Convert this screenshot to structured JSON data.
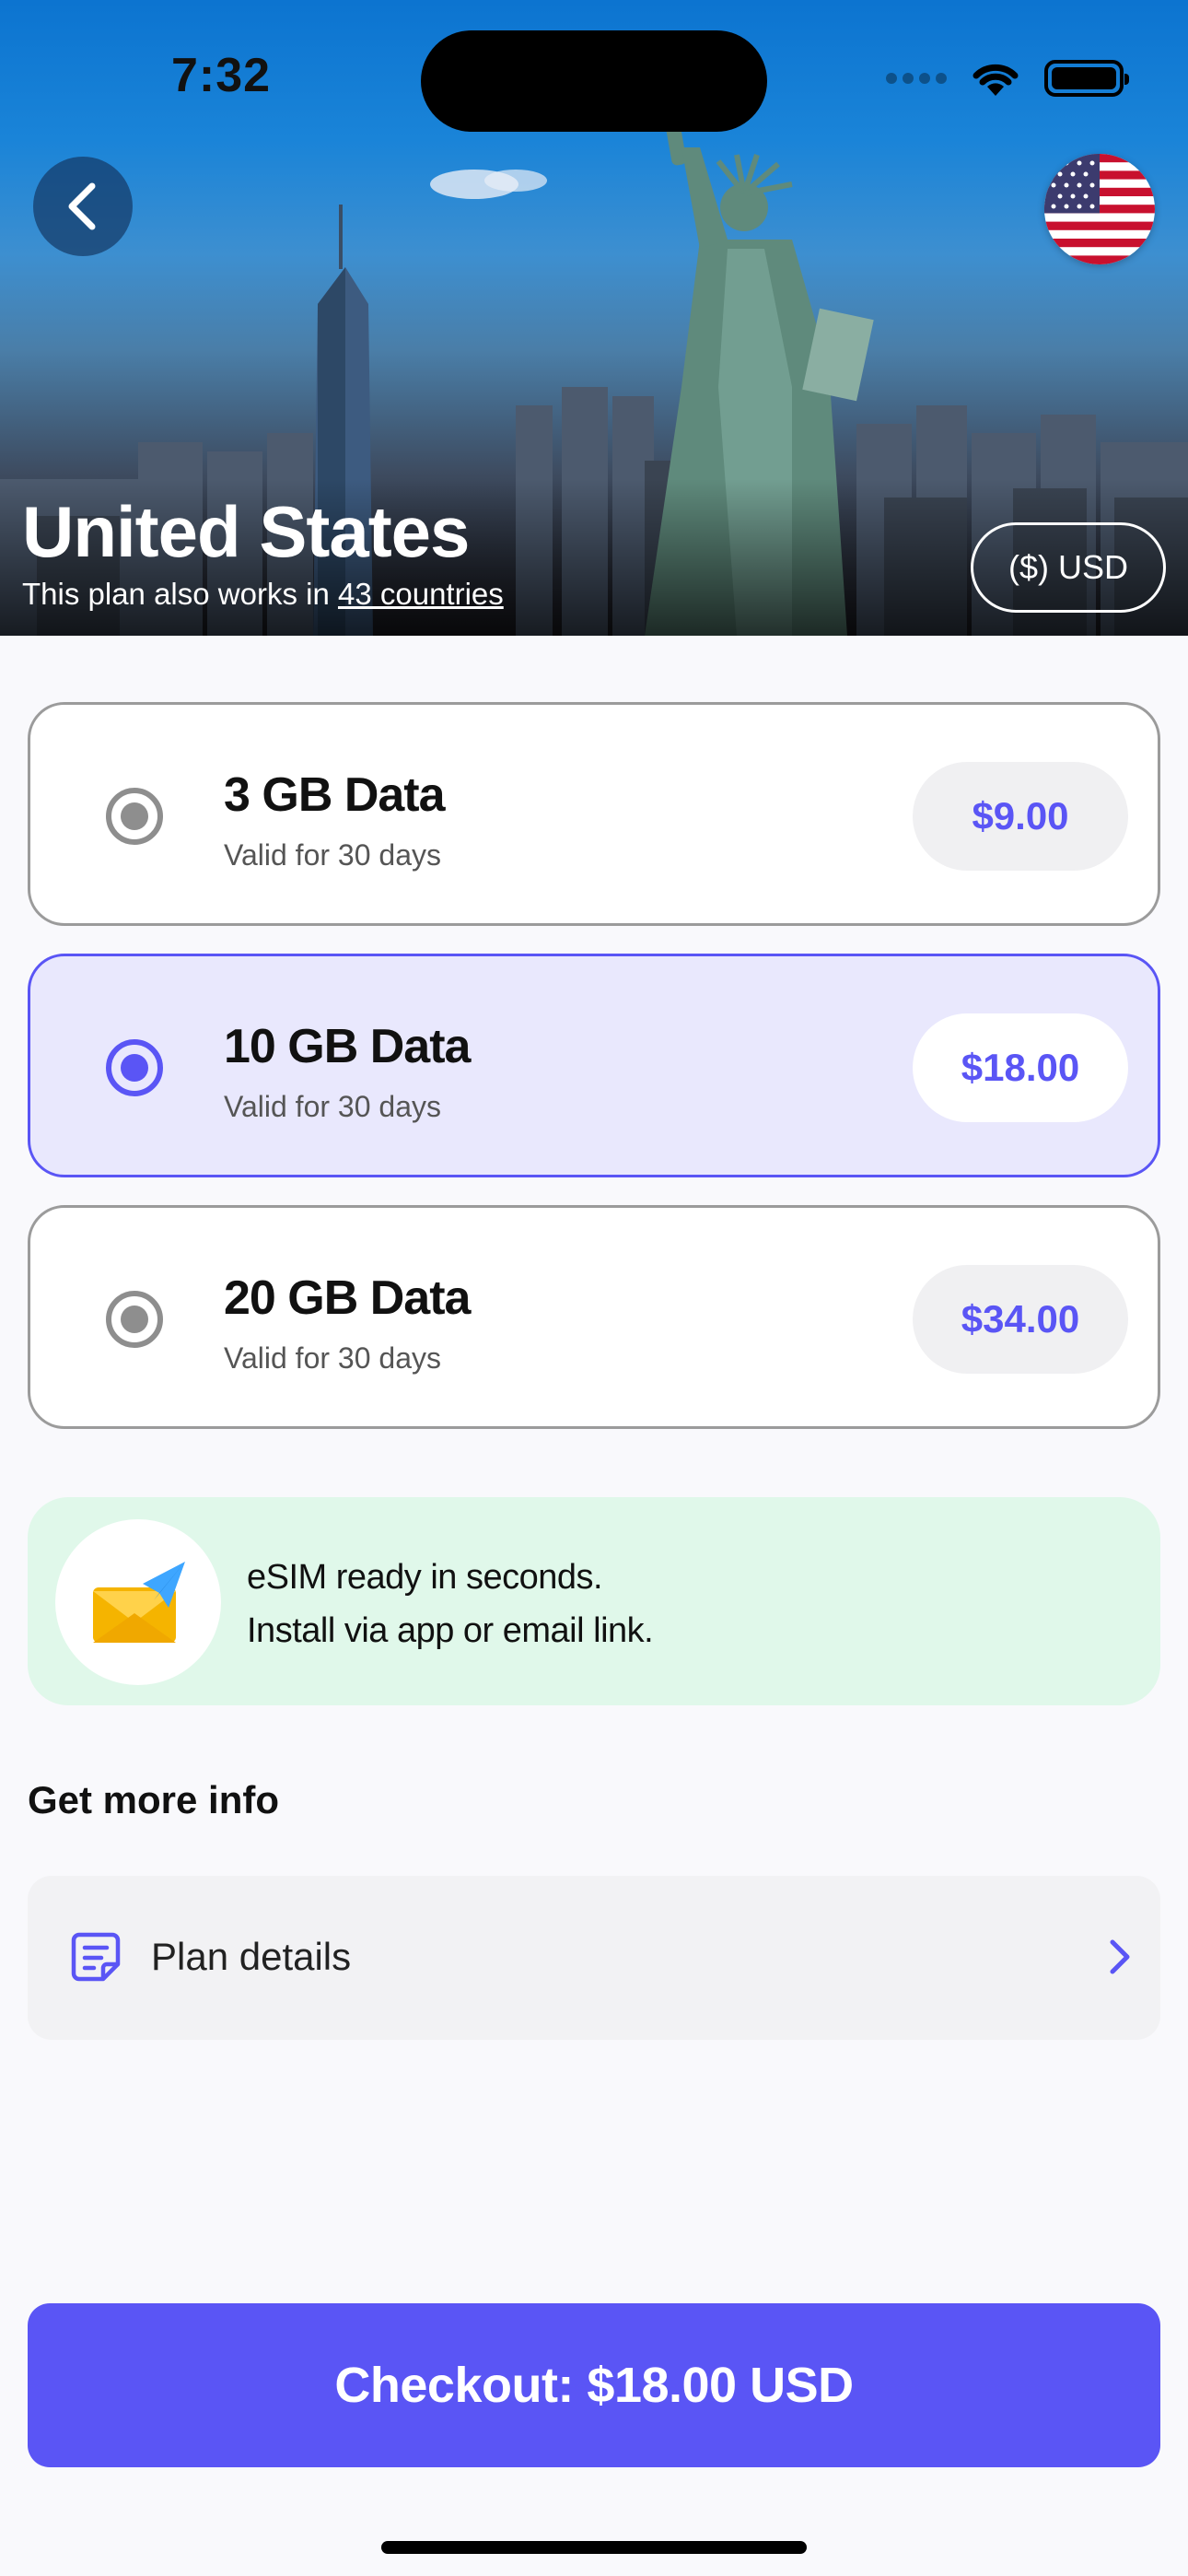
{
  "status_bar": {
    "time": "7:32"
  },
  "hero": {
    "title": "United States",
    "subtitle_prefix": "This plan also works in ",
    "subtitle_link": "43 countries",
    "currency_label": "($) USD"
  },
  "plans": [
    {
      "name": "3 GB Data",
      "validity": "Valid for 30 days",
      "price": "$9.00",
      "selected": false
    },
    {
      "name": "10 GB Data",
      "validity": "Valid for 30 days",
      "price": "$18.00",
      "selected": true
    },
    {
      "name": "20 GB Data",
      "validity": "Valid for 30 days",
      "price": "$34.00",
      "selected": false
    }
  ],
  "info_banner": {
    "line1": "eSIM ready in seconds.",
    "line2": "Install via app or email link."
  },
  "more_info": {
    "title": "Get more info",
    "plan_details_label": "Plan details"
  },
  "checkout": {
    "label": "Checkout: $18.00 USD"
  },
  "colors": {
    "accent": "#5a55f5",
    "selected_bg": "#e9e8fd",
    "banner_bg": "#e0f8ea"
  }
}
